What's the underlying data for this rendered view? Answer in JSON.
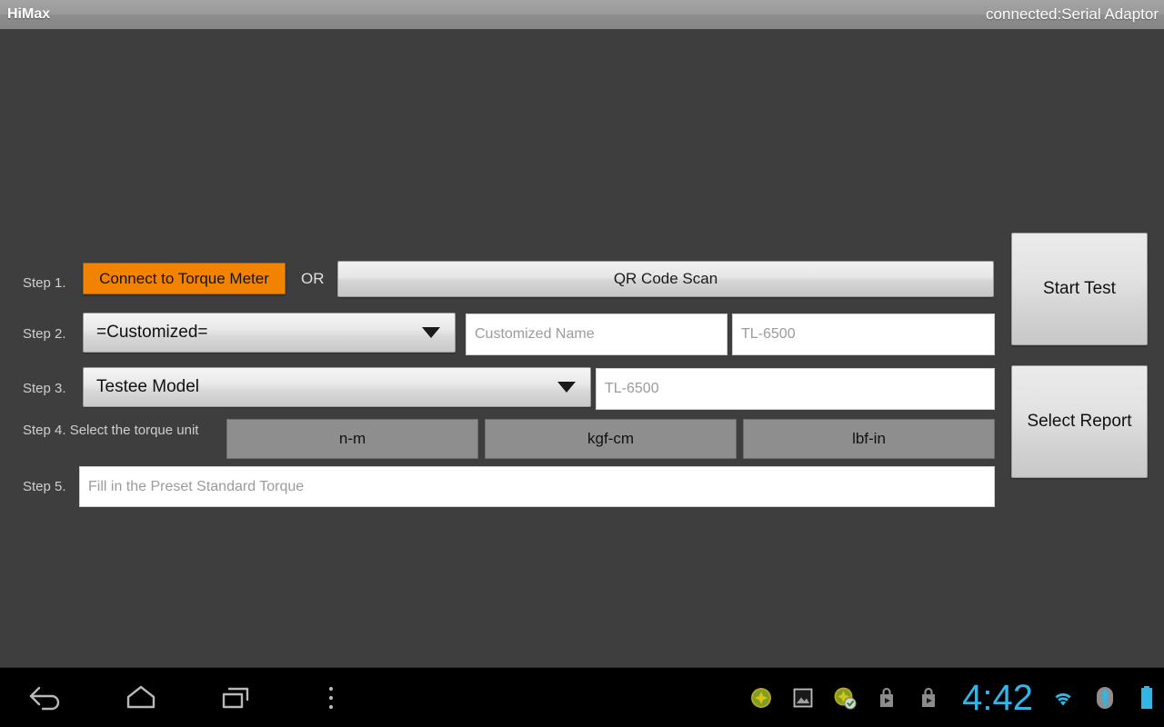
{
  "titlebar": {
    "app_title": "HiMax",
    "connection_status": "connected:Serial Adaptor"
  },
  "form": {
    "step1": {
      "label": "Step 1.",
      "connect_button": "Connect to Torque Meter",
      "or_text": "OR",
      "qr_button": "QR Code Scan"
    },
    "step2": {
      "label": "Step 2.",
      "spinner_value": "=Customized=",
      "name_placeholder": "Customized Name",
      "model_placeholder": "TL-6500"
    },
    "step3": {
      "label": "Step 3.",
      "spinner_value": "Testee Model",
      "model_placeholder": "TL-6500"
    },
    "step4": {
      "label": "Step 4. Select the torque unit",
      "units": [
        "n-m",
        "kgf-cm",
        "lbf-in"
      ]
    },
    "step5": {
      "label": "Step 5.",
      "torque_placeholder": "Fill in the Preset Standard Torque"
    }
  },
  "side_actions": {
    "start_test": "Start Test",
    "select_report": "Select Report"
  },
  "navbar": {
    "buttons": [
      "back-icon",
      "home-icon",
      "recents-icon",
      "overflow-menu-icon"
    ],
    "tray_icons": [
      "app-update-icon",
      "screenshot-icon",
      "app-installed-icon",
      "play-store-icon",
      "play-store-icon-2"
    ],
    "clock": "4:42",
    "status_icons": [
      "wifi-icon",
      "bluetooth-icon",
      "battery-icon"
    ]
  },
  "colors": {
    "accent_orange": "#f28300",
    "body_background": "#3e3e3e",
    "status_blue": "#33b5e5",
    "unit_button": "#8e8e8e"
  }
}
